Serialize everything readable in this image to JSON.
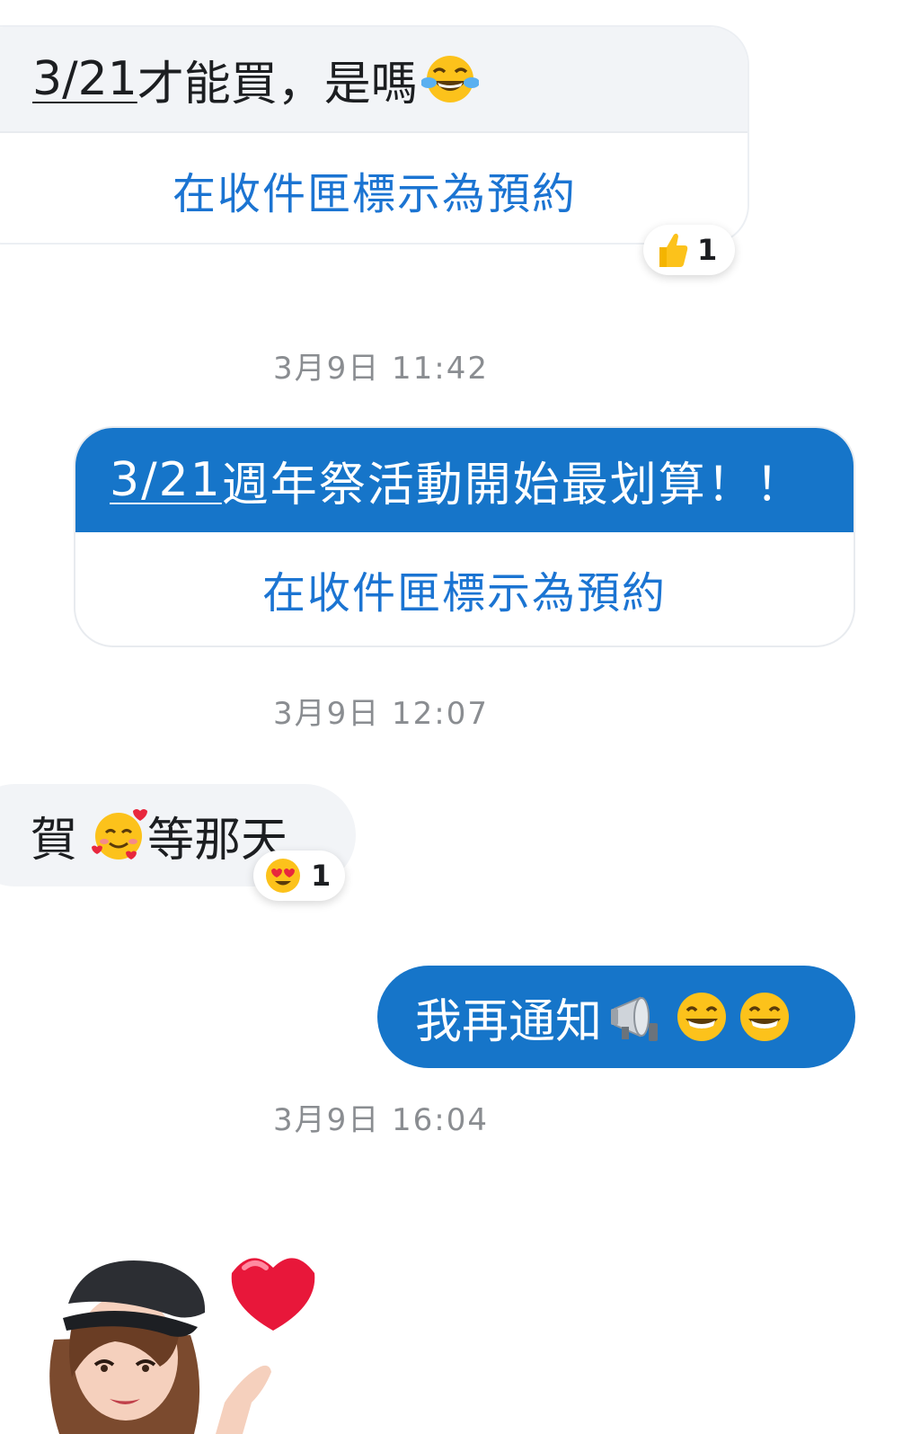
{
  "messages": {
    "m1": {
      "date_text": "3/21",
      "rest_text": "才能買，是嗎",
      "emoji": "tears-of-joy",
      "action_label": "在收件匣標示為預約",
      "reaction": {
        "emoji": "thumbs-up",
        "count": "1"
      }
    },
    "ts1": "3月9日 11:42",
    "m2": {
      "date_text": "3/21",
      "rest_text": "週年祭活動開始最划算！！",
      "action_label": "在收件匣標示為預約"
    },
    "ts2": "3月9日 12:07",
    "m3": {
      "text_a": "賀",
      "emoji": "smiling-face-with-hearts",
      "text_b": "等那天",
      "reaction": {
        "emoji": "heart-eyes",
        "count": "1"
      }
    },
    "m4": {
      "text": "我再通知",
      "emojis": [
        "loudspeaker",
        "grinning-face",
        "grinning-face"
      ]
    },
    "ts3": "3月9日 16:04",
    "sticker": {
      "name": "avatar-finger-heart-sticker"
    }
  },
  "colors": {
    "outgoing_bubble": "#1675c9",
    "incoming_bubble": "#f2f4f7",
    "action_link": "#1b74d2",
    "timestamp": "#8a8d91"
  }
}
